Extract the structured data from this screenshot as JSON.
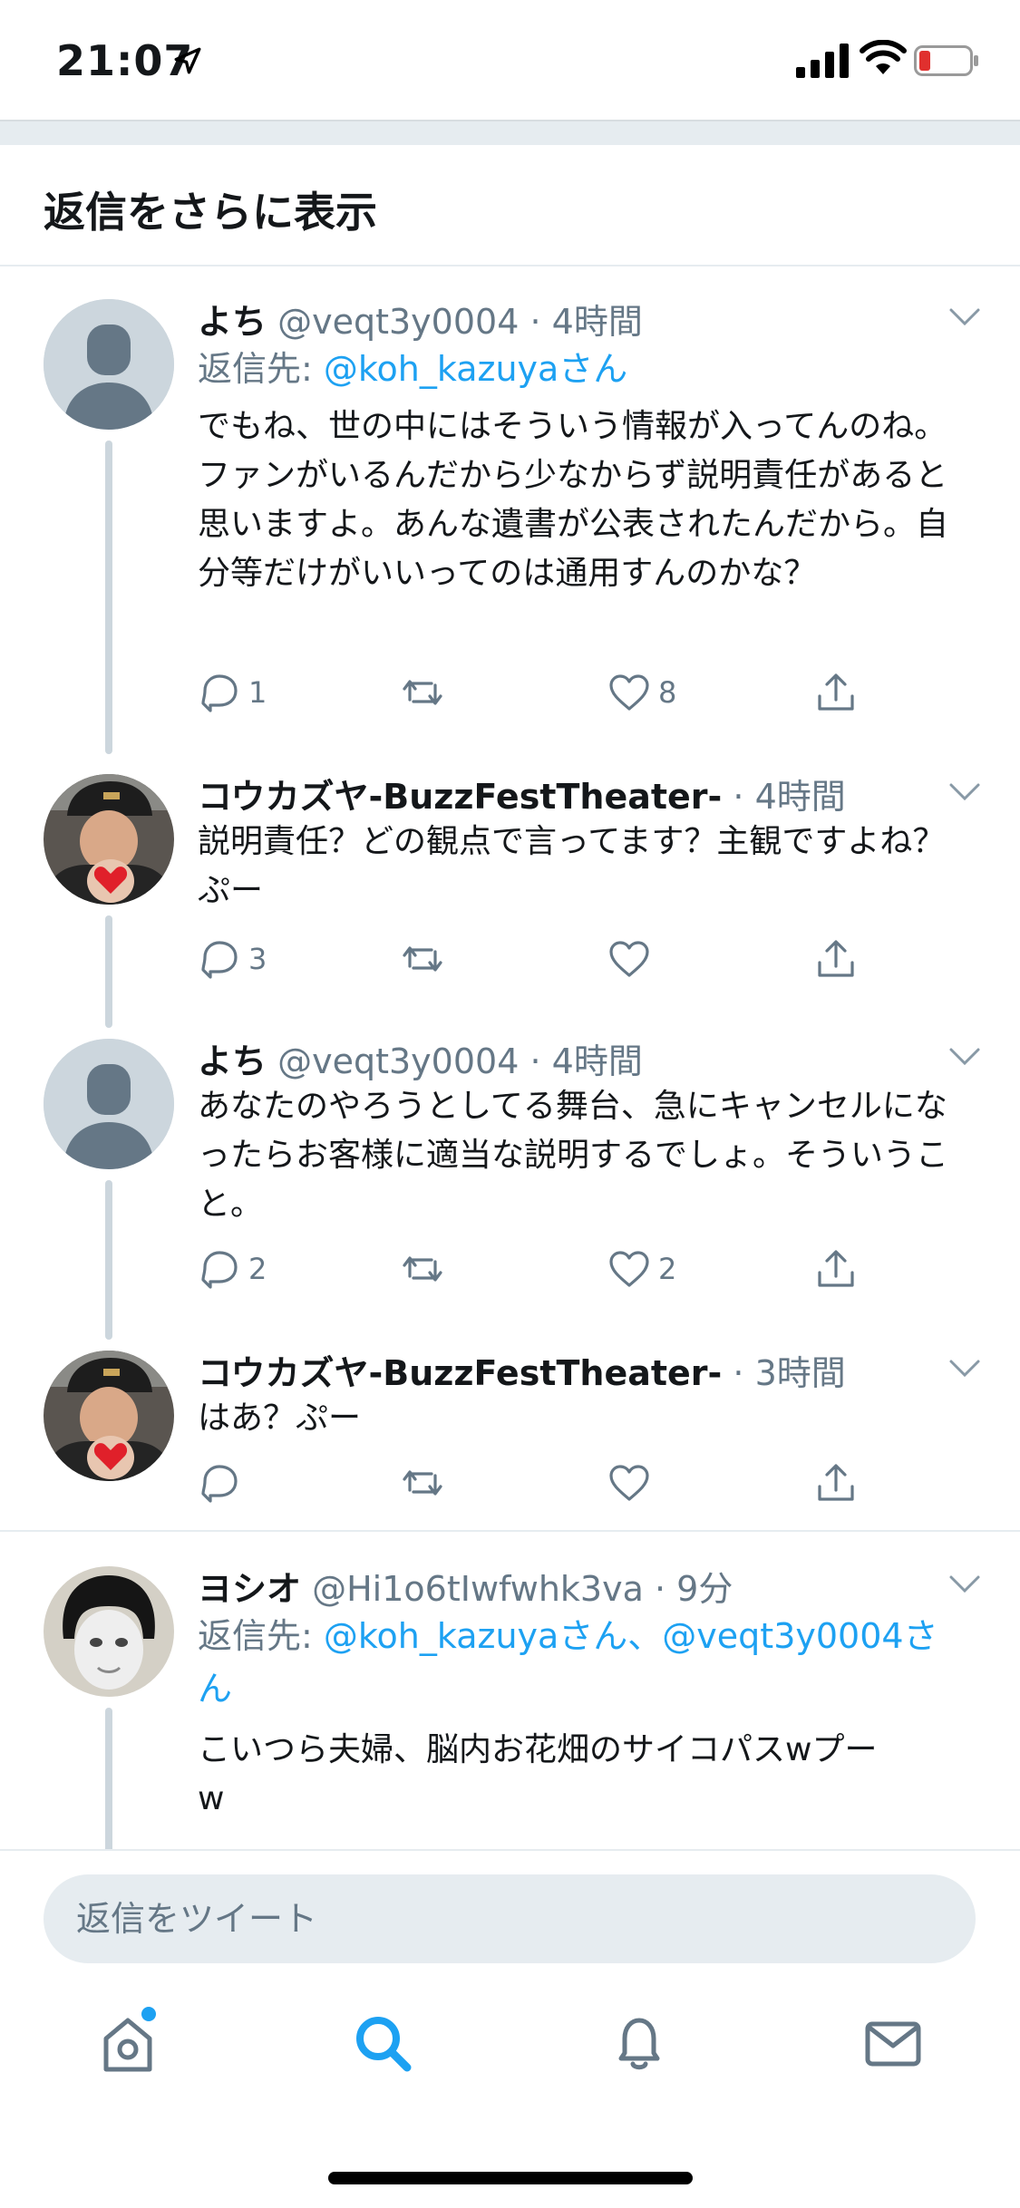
{
  "status_bar": {
    "time": "21:07"
  },
  "more_replies": {
    "label": "返信をさらに表示"
  },
  "tweets": [
    {
      "name": "よち",
      "handle": "@veqt3y0004",
      "time": "4時間",
      "reply_prefix": "返信先: ",
      "reply_to": "@koh_kazuyaさん",
      "text": "でもね、世の中にはそういう情報が入ってんのね。ファンがいるんだから少なからず説明責任があると思いますよ。あんな遺書が公表されたんだから。自分等だけがいいってのは通用すんのかな？",
      "replies": "1",
      "retweets": "",
      "likes": "8",
      "avatar": "default-avatar"
    },
    {
      "name": "コウカズヤ-BuzzFestTheater-",
      "handle": "",
      "time": "4時間",
      "text": "説明責任？どの観点で言ってます？主観ですよね？ぷー",
      "replies": "3",
      "retweets": "",
      "likes": "",
      "avatar": "photo-avatar-cap"
    },
    {
      "name": "よち",
      "handle": "@veqt3y0004",
      "time": "4時間",
      "text": "あなたのやろうとしてる舞台、急にキャンセルになったらお客様に適当な説明するでしょ。そういうこと。",
      "replies": "2",
      "retweets": "",
      "likes": "2",
      "avatar": "default-avatar"
    },
    {
      "name": "コウカズヤ-BuzzFestTheater-",
      "handle": "",
      "time": "3時間",
      "text": "はあ？ぷー",
      "replies": "",
      "retweets": "",
      "likes": "",
      "avatar": "photo-avatar-cap"
    },
    {
      "name": "ヨシオ",
      "handle": "@Hi1o6tIwfwhk3va",
      "time": "9分",
      "reply_prefix": "返信先: ",
      "reply_to": "@koh_kazuyaさん、@veqt3y0004さん",
      "text": "こいつら夫婦、脳内お花畑のサイコパスwプーw",
      "avatar": "photo-avatar-bowl"
    }
  ],
  "reply_bar": {
    "placeholder": "返信をツイート"
  },
  "nav": {
    "items": [
      "home-icon",
      "search-icon",
      "notifications-icon",
      "messages-icon"
    ],
    "active": "search-icon"
  },
  "colors": {
    "accent": "#1da1f2",
    "secondary_text": "#657786",
    "divider": "#e6ecf0"
  }
}
